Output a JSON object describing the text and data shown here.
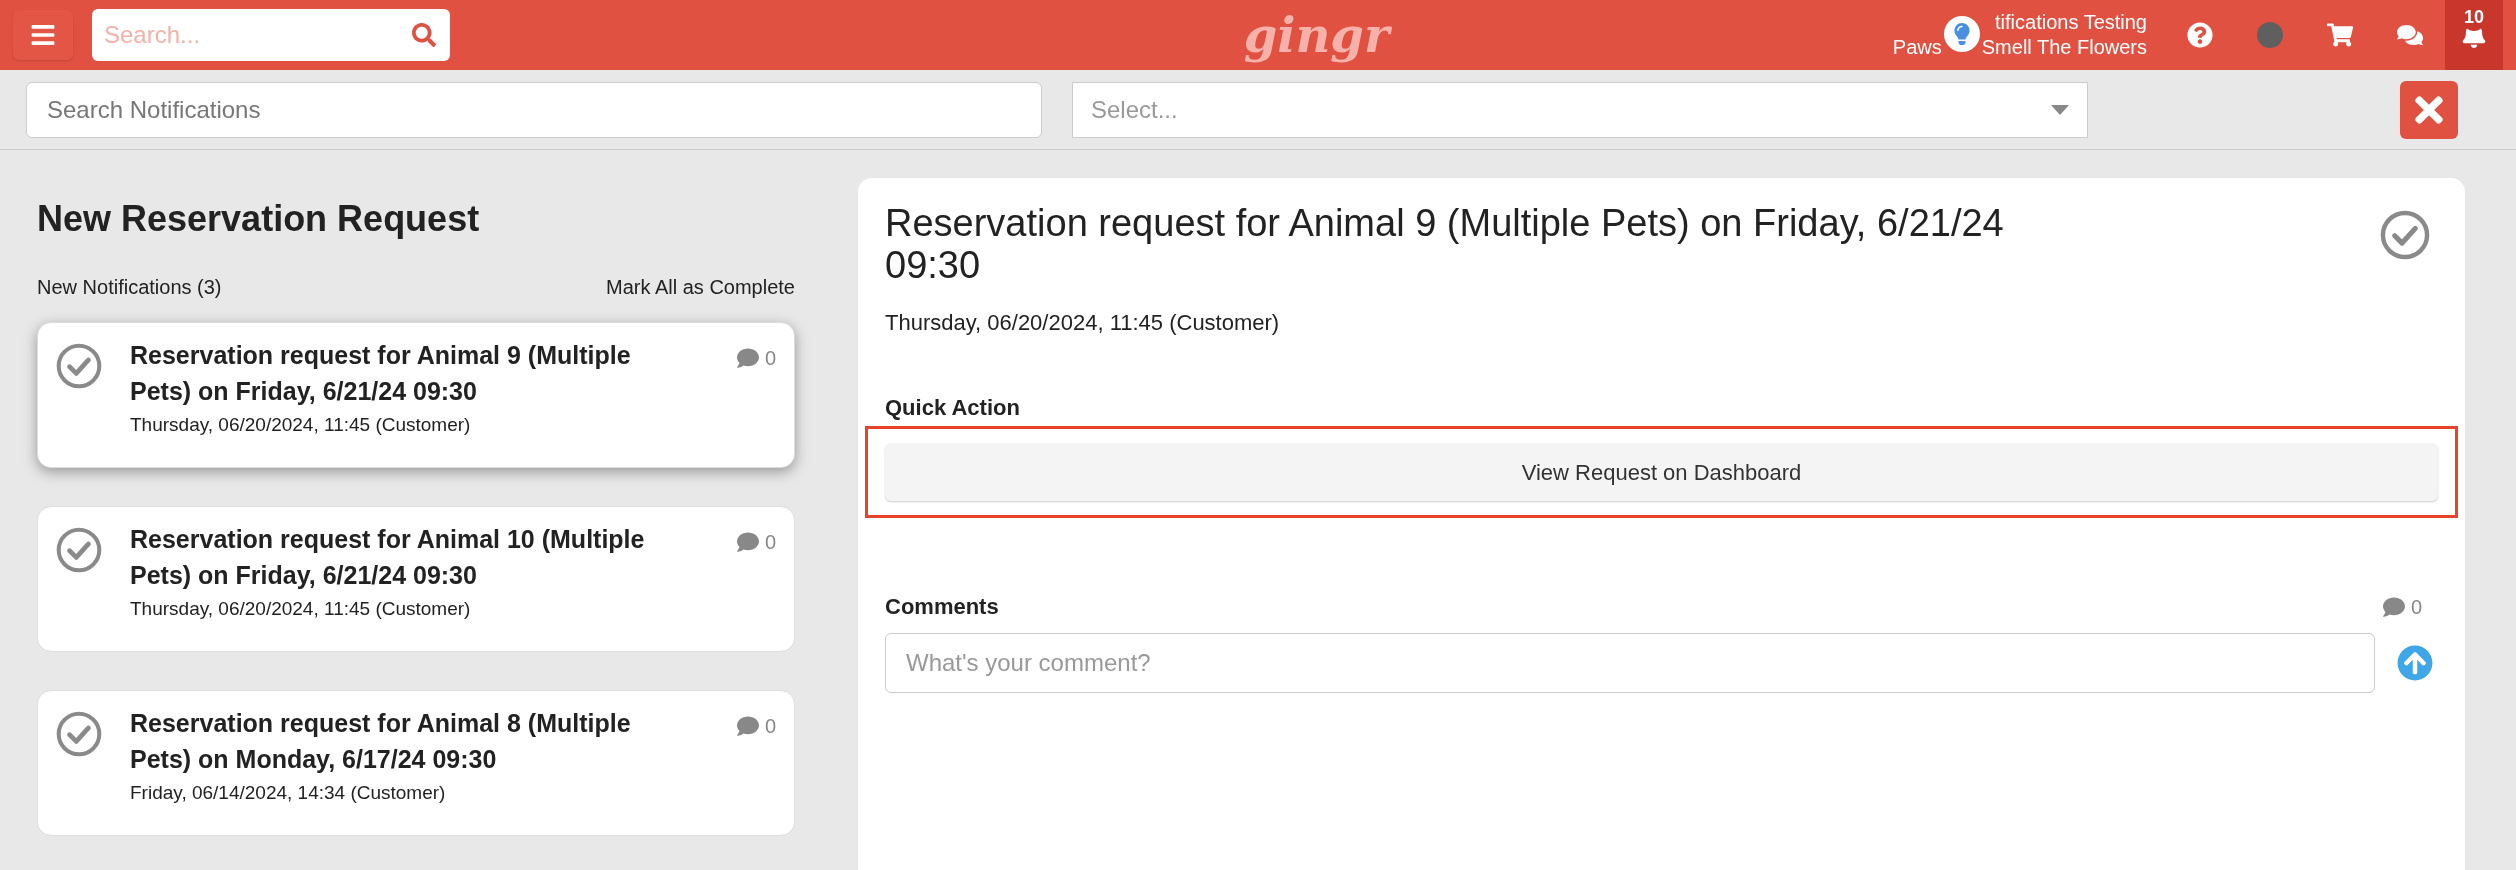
{
  "header": {
    "search": {
      "placeholder": "Search..."
    },
    "logo": "gingr",
    "user": {
      "line_1": "tifications Testing",
      "line_2a": "Paws",
      "line_2b": "Smell The Flowers"
    },
    "notifications_badge": "10"
  },
  "filters": {
    "search": {
      "placeholder": "Search Notifications"
    },
    "select": {
      "placeholder": "Select..."
    }
  },
  "list": {
    "title": "New Reservation Request",
    "count_label": "New Notifications (3)",
    "mark_all": "Mark All as Complete",
    "items": [
      {
        "title": "Reservation request for Animal 9 (Multiple Pets) on Friday, 6/21/24 09:30",
        "meta": "Thursday, 06/20/2024, 11:45 (Customer)",
        "comments": "0",
        "selected": true
      },
      {
        "title": "Reservation request for Animal 10 (Multiple Pets) on Friday, 6/21/24 09:30",
        "meta": "Thursday, 06/20/2024, 11:45 (Customer)",
        "comments": "0",
        "selected": false
      },
      {
        "title": "Reservation request for Animal 8 (Multiple Pets) on Monday, 6/17/24 09:30",
        "meta": "Friday, 06/14/2024, 14:34 (Customer)",
        "comments": "0",
        "selected": false
      }
    ]
  },
  "detail": {
    "title": "Reservation request for Animal 9 (Multiple Pets) on Friday, 6/21/24 09:30",
    "meta": "Thursday, 06/20/2024, 11:45 (Customer)",
    "quick_action_label": "Quick Action",
    "quick_action_button": "View Request on Dashboard",
    "comments_label": "Comments",
    "comments_count": "0",
    "comment_field": {
      "placeholder": "What's your comment?"
    }
  }
}
